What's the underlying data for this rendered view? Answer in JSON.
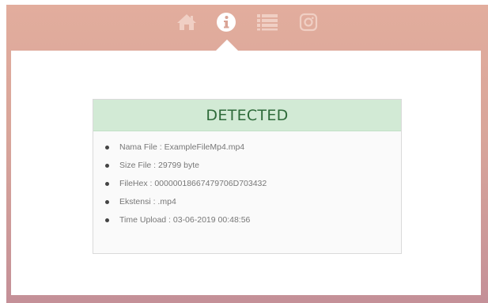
{
  "nav": {
    "items": [
      {
        "icon": "home-icon",
        "active": false
      },
      {
        "icon": "info-icon",
        "active": true
      },
      {
        "icon": "list-icon",
        "active": false
      },
      {
        "icon": "instagram-icon",
        "active": false
      }
    ]
  },
  "colors": {
    "background_top": "#e2ad9d",
    "background_bottom": "#c49098",
    "header_bg": "#d2ead5",
    "header_text": "#2f6b3a"
  },
  "result": {
    "title": "DETECTED",
    "items": [
      "Nama File : ExampleFileMp4.mp4",
      "Size File : 29799 byte",
      "FileHex : 00000018667479706D703432",
      "Ekstensi : .mp4",
      "Time Upload : 03-06-2019 00:48:56"
    ]
  }
}
